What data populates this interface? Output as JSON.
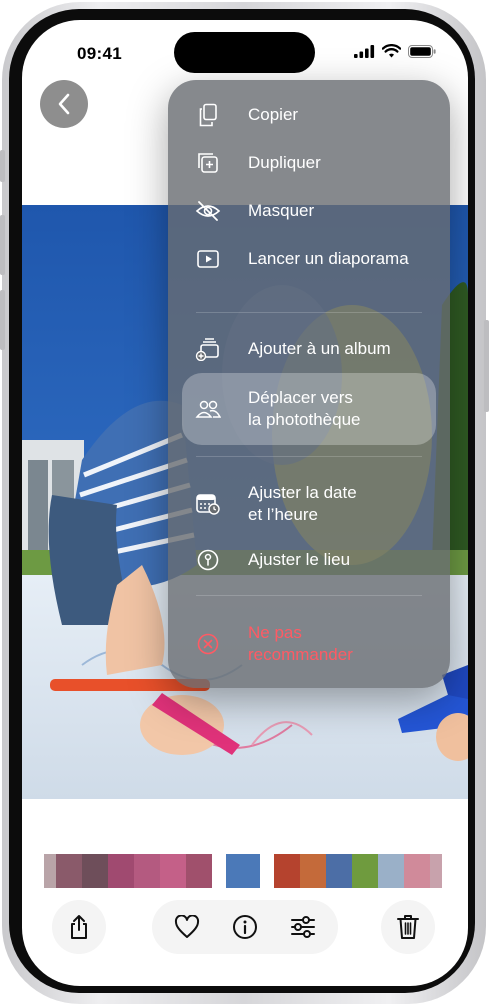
{
  "status_bar": {
    "time": "09:41"
  },
  "menu": {
    "items": [
      {
        "label": "Copier",
        "icon": "copy-icon"
      },
      {
        "label": "Dupliquer",
        "icon": "duplicate-icon"
      },
      {
        "label": "Masquer",
        "icon": "eye-slash-icon"
      },
      {
        "label": "Lancer un diaporama",
        "icon": "play-rectangle-icon"
      },
      {
        "label": "Ajouter à un album",
        "icon": "add-to-album-icon"
      },
      {
        "label": "Déplacer vers\nla photothèque",
        "icon": "people-icon",
        "highlighted": true
      },
      {
        "label": "Ajuster la date\net l’heure",
        "icon": "calendar-clock-icon"
      },
      {
        "label": "Ajuster le lieu",
        "icon": "location-pin-icon"
      },
      {
        "label": "Ne pas\nrecommander",
        "icon": "x-circle-icon",
        "destructive": true
      }
    ]
  },
  "toolbar": {
    "share_icon": "share-icon",
    "favorite_icon": "heart-icon",
    "info_icon": "info-icon",
    "adjust_icon": "sliders-icon",
    "delete_icon": "trash-icon"
  },
  "colors": {
    "destructive": "#ff5a64",
    "sky": "#2a62b2",
    "menu_background": "#686c70"
  }
}
